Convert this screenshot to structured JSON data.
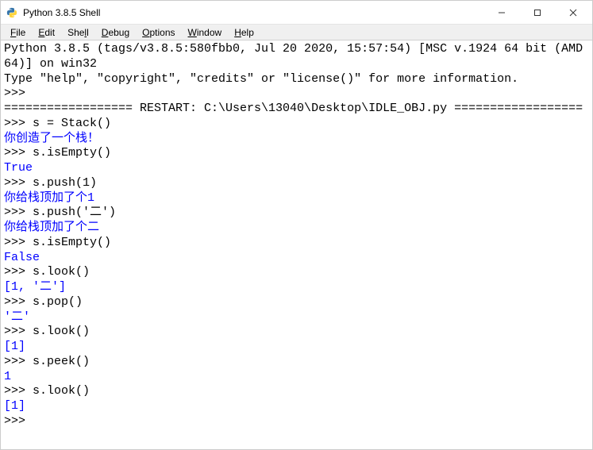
{
  "window": {
    "title": "Python 3.8.5 Shell"
  },
  "menu": {
    "items": [
      {
        "u": "F",
        "rest": "ile"
      },
      {
        "u": "E",
        "rest": "dit"
      },
      {
        "u": "",
        "pre": "She",
        "urest": "l",
        "post": "l"
      },
      {
        "u": "D",
        "rest": "ebug"
      },
      {
        "u": "O",
        "rest": "ptions"
      },
      {
        "u": "W",
        "rest": "indow"
      },
      {
        "u": "H",
        "rest": "elp"
      }
    ]
  },
  "console": {
    "banner1": "Python 3.8.5 (tags/v3.8.5:580fbb0, Jul 20 2020, 15:57:54) [MSC v.1924 64 bit (AMD64)] on win32",
    "banner2": "Type \"help\", \"copyright\", \"credits\" or \"license()\" for more information.",
    "prompt": ">>>",
    "restart_line": "================== RESTART: C:\\Users\\13040\\Desktop\\IDLE_OBJ.py ==================",
    "lines": [
      {
        "type": "prompt",
        "text": ""
      },
      {
        "type": "restart"
      },
      {
        "type": "input",
        "code": "s = Stack()"
      },
      {
        "type": "stdout",
        "text": "你创造了一个栈！"
      },
      {
        "type": "input",
        "code": "s.isEmpty()"
      },
      {
        "type": "result",
        "text": "True"
      },
      {
        "type": "input",
        "code": "s.push(1)"
      },
      {
        "type": "stdout_mixed",
        "prefix": "你给栈顶加了个",
        "val": "1"
      },
      {
        "type": "input",
        "code": "s.push('二')"
      },
      {
        "type": "stdout_mixed",
        "prefix": "你给栈顶加了个",
        "val": "二"
      },
      {
        "type": "input",
        "code": "s.isEmpty()"
      },
      {
        "type": "result",
        "text": "False"
      },
      {
        "type": "input",
        "code": "s.look()"
      },
      {
        "type": "result",
        "text": "[1, '二']"
      },
      {
        "type": "input",
        "code": "s.pop()"
      },
      {
        "type": "result",
        "text": "'二'"
      },
      {
        "type": "input",
        "code": "s.look()"
      },
      {
        "type": "result",
        "text": "[1]"
      },
      {
        "type": "input",
        "code": "s.peek()"
      },
      {
        "type": "result",
        "text": "1"
      },
      {
        "type": "input",
        "code": "s.look()"
      },
      {
        "type": "result",
        "text": "[1]"
      },
      {
        "type": "prompt",
        "text": ""
      }
    ]
  }
}
